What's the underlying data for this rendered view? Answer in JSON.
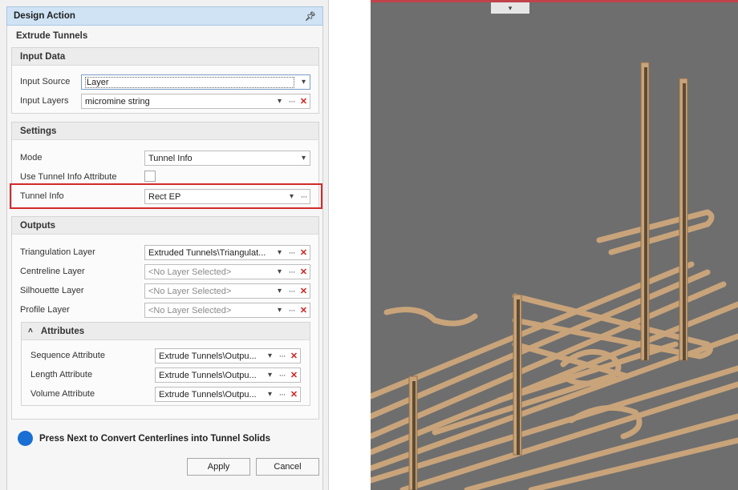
{
  "panel": {
    "title": "Design Action",
    "pin_icon": "pin-icon",
    "subtitle": "Extrude Tunnels"
  },
  "input_data": {
    "header": "Input Data",
    "source_label": "Input Source",
    "source_value": "Layer",
    "layers_label": "Input Layers",
    "layers_value": "micromine string"
  },
  "settings": {
    "header": "Settings",
    "mode_label": "Mode",
    "mode_value": "Tunnel Info",
    "use_attr_label": "Use Tunnel Info Attribute",
    "use_attr_checked": false,
    "tunnel_info_label": "Tunnel Info",
    "tunnel_info_value": "Rect EP"
  },
  "outputs": {
    "header": "Outputs",
    "triangulation_label": "Triangulation Layer",
    "triangulation_value": "Extruded Tunnels\\Triangulat...",
    "centreline_label": "Centreline Layer",
    "centreline_value": "<No Layer Selected>",
    "silhouette_label": "Silhouette Layer",
    "silhouette_value": "<No Layer Selected>",
    "profile_label": "Profile Layer",
    "profile_value": "<No Layer Selected>"
  },
  "attributes": {
    "header": "Attributes",
    "sequence_label": "Sequence Attribute",
    "sequence_value": "Extrude Tunnels\\Outpu...",
    "length_label": "Length Attribute",
    "length_value": "Extrude Tunnels\\Outpu...",
    "volume_label": "Volume Attribute",
    "volume_value": "Extrude Tunnels\\Outpu..."
  },
  "footer": {
    "message": "Press Next to Convert Centerlines into Tunnel Solids",
    "apply_label": "Apply",
    "cancel_label": "Cancel"
  },
  "viewport": {
    "background": "#6e6e6e",
    "tunnel_color": "#d2b48c",
    "pillar_color": "#5a4a36",
    "accent_line": "#c0434b"
  }
}
